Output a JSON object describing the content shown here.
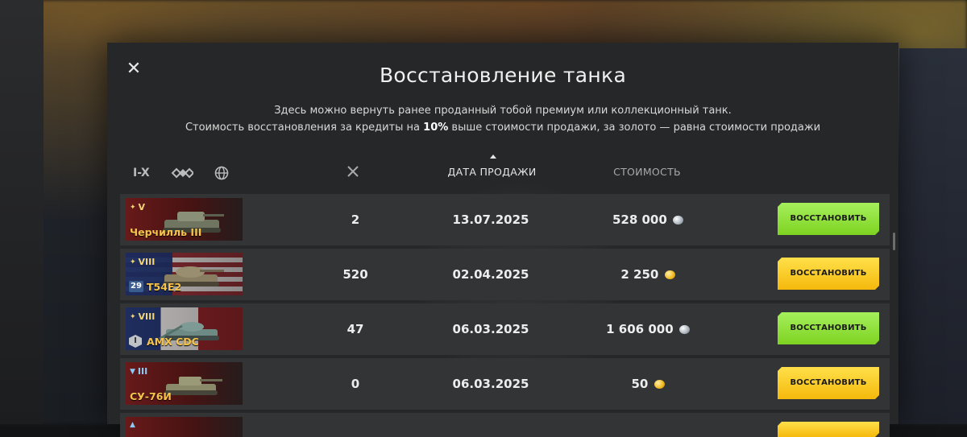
{
  "modal": {
    "close_symbol": "✕",
    "title": "Восстановление танка",
    "description_line1": "Здесь можно вернуть ранее проданный тобой премиум или коллекционный танк.",
    "description_line2_prefix": "Стоимость восстановления за кредиты на ",
    "description_line2_bold": "10%",
    "description_line2_suffix": " выше стоимости продажи, за золото — равна стоимости продажи"
  },
  "filters": {
    "tier_label": "I-X",
    "class_icon": "tank-class-icon",
    "nation_icon": "globe-icon"
  },
  "columns": {
    "battles_icon": "crossed-swords-icon",
    "sale_date": "ДАТА ПРОДАЖИ",
    "cost": "СТОИМОСТЬ"
  },
  "colors": {
    "button_green": "#7ed321",
    "button_gold": "#f5b90c",
    "tank_name": "#f6c44c"
  },
  "rows": [
    {
      "tier": "V",
      "tier_icon": "premium-star-icon",
      "name": "Черчилль III",
      "flag": "ussr",
      "battles": "2",
      "date": "13.07.2025",
      "cost": "528 000",
      "currency": "silver",
      "button": "ВОССТАНОВИТЬ",
      "button_color": "green"
    },
    {
      "tier": "VIII",
      "tier_icon": "premium-icon",
      "name": "T54E2",
      "flag": "usa",
      "mastery": "29",
      "battles": "520",
      "date": "02.04.2025",
      "cost": "2 250",
      "currency": "gold",
      "button": "ВОССТАНОВИТЬ",
      "button_color": "gold"
    },
    {
      "tier": "VIII",
      "tier_icon": "premium-icon",
      "name": "AMX CDC",
      "flag": "france",
      "mastery": "I",
      "battles": "47",
      "date": "06.03.2025",
      "cost": "1 606 000",
      "currency": "silver",
      "button": "ВОССТАНОВИТЬ",
      "button_color": "green"
    },
    {
      "tier": "III",
      "tier_icon": "collector-icon",
      "name": "СУ-76И",
      "flag": "ussr",
      "battles": "0",
      "date": "06.03.2025",
      "cost": "50",
      "currency": "gold",
      "button": "ВОССТАНОВИТЬ",
      "button_color": "gold"
    }
  ]
}
